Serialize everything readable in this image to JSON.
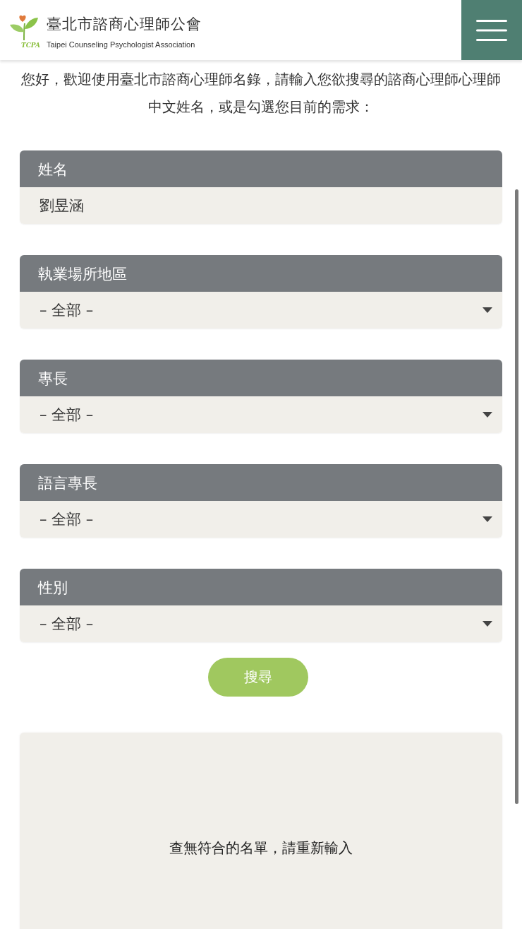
{
  "header": {
    "title": "臺北市諮商心理師公會",
    "subtitle": "Taipei Counseling Psychologist Association",
    "logo_text": "TCPA"
  },
  "intro": "您好，歡迎使用臺北市諮商心理師名錄，請輸入您欲搜尋的諮商心理師心理師中文姓名，或是勾選您目前的需求：",
  "fields": [
    {
      "label": "姓名",
      "kind": "text",
      "value": "劉昱涵"
    },
    {
      "label": "執業場所地區",
      "kind": "select",
      "value": "– 全部 –"
    },
    {
      "label": "專長",
      "kind": "select",
      "value": "– 全部 –"
    },
    {
      "label": "語言專長",
      "kind": "select",
      "value": "– 全部 –"
    },
    {
      "label": "性別",
      "kind": "select",
      "value": "– 全部 –"
    }
  ],
  "search_button": "搜尋",
  "result_message": "查無符合的名單，請重新輸入"
}
